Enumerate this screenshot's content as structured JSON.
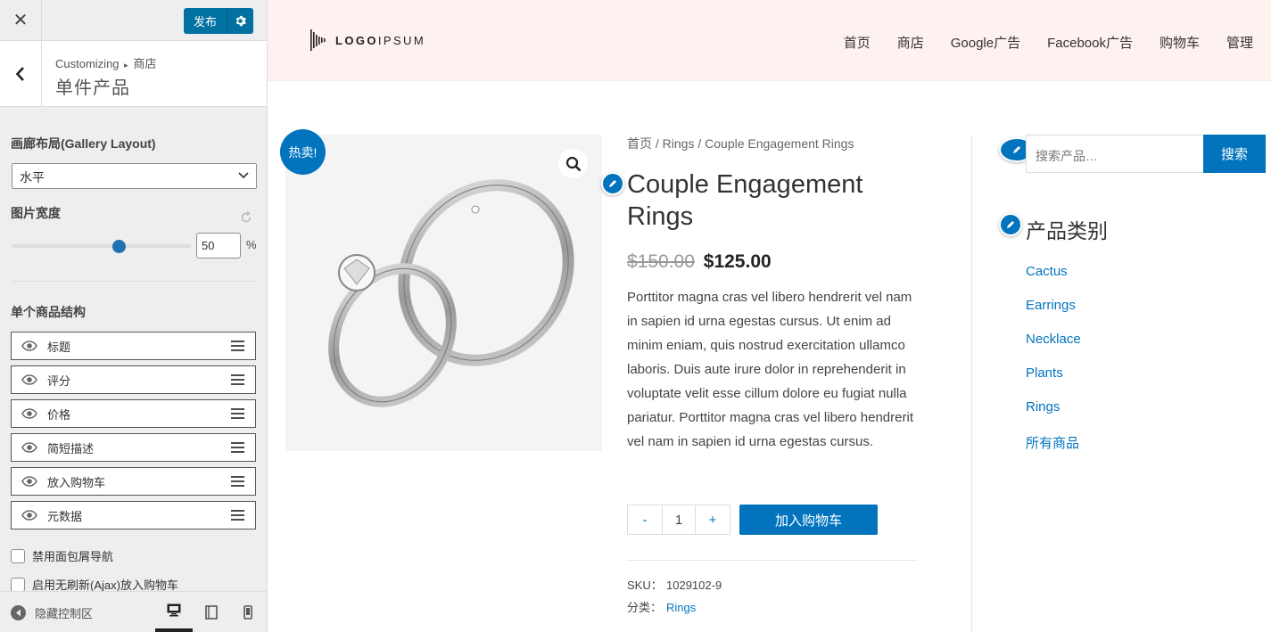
{
  "customizer": {
    "close_label": "✕",
    "publish_label": "发布",
    "breadcrumb_root": "Customizing",
    "breadcrumb_arrow": "▸",
    "breadcrumb_section": "商店",
    "section_title": "单件产品",
    "gallery_layout_label": "画廊布局(Gallery Layout)",
    "gallery_layout_value": "水平",
    "image_width_label": "图片宽度",
    "image_width_value": "50",
    "image_width_unit": "%",
    "image_width_slider_fraction": 0.5,
    "structure_label": "单个商品结构",
    "structure_items": [
      "标题",
      "评分",
      "价格",
      "简短描述",
      "放入购物车",
      "元数据"
    ],
    "checkboxes": [
      "禁用面包屑导航",
      "启用无刷新(Ajax)放入购物车"
    ],
    "hide_controls_label": "隐藏控制区"
  },
  "site": {
    "logo_text_a": "LOGO",
    "logo_text_b": "IPSUM",
    "nav": [
      "首页",
      "商店",
      "Google广告",
      "Facebook广告",
      "购物车",
      "管理"
    ]
  },
  "product": {
    "sale_badge": "热卖!",
    "breadcrumb": "首页 / Rings / Couple Engagement Rings",
    "title": "Couple Engagement Rings",
    "price_old": "$150.00",
    "price_new": "$125.00",
    "description": "Porttitor magna cras vel  libero hendrerit vel nam in sapien id urna egestas cursus. Ut enim ad minim eniam, quis nostrud exercitation ullamco laboris. Duis aute irure dolor in reprehenderit in voluptate velit esse cillum dolore eu fugiat nulla pariatur. Porttitor magna cras vel  libero hendrerit vel nam in sapien id urna egestas cursus.",
    "qty_minus": "-",
    "qty_value": "1",
    "qty_plus": "+",
    "add_to_cart": "加入购物车",
    "sku_label": "SKU：",
    "sku_value": "1029102-9",
    "category_label": "分类：",
    "category_value": "Rings"
  },
  "sidebar": {
    "search_placeholder": "搜索产品…",
    "search_button": "搜索",
    "widget_title": "产品类别",
    "categories": [
      "Cactus",
      "Earrings",
      "Necklace",
      "Plants",
      "Rings",
      "所有商品"
    ]
  },
  "colors": {
    "accent": "#0274be",
    "header_bg": "#fdf2f0",
    "customizer_bg": "#eeeeee"
  }
}
